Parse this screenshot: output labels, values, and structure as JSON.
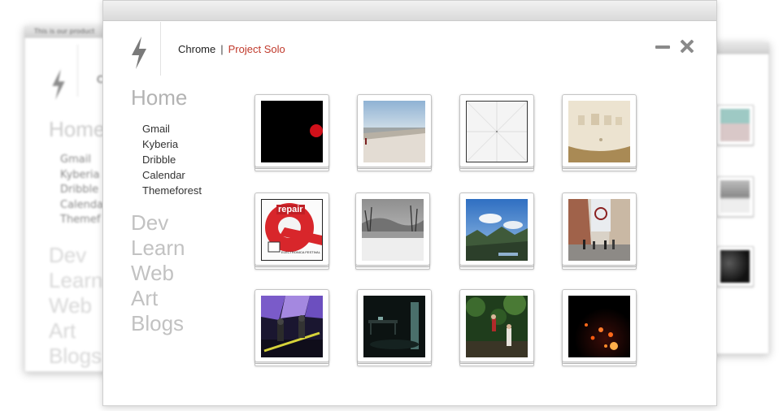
{
  "background_left_window": {
    "title": "This is our product",
    "brand_initial": "C",
    "home_label": "Home",
    "home_links": [
      "Gmail",
      "Kyberia",
      "Dribble",
      "Calenda",
      "Themef"
    ],
    "categories": [
      "Dev",
      "Learn",
      "Web",
      "Art",
      "Blogs"
    ]
  },
  "header": {
    "app_name": "Chrome",
    "separator": "|",
    "project": "Project Solo"
  },
  "sidebar": {
    "home_label": "Home",
    "home_links": [
      "Gmail",
      "Kyberia",
      "Dribble",
      "Calendar",
      "Themeforest"
    ],
    "categories": [
      "Dev",
      "Learn",
      "Web",
      "Art",
      "Blogs"
    ]
  },
  "thumbnails": [
    {
      "scene": "black-with-red-dot"
    },
    {
      "scene": "plaza-sky"
    },
    {
      "scene": "grid-placeholder"
    },
    {
      "scene": "sculpted-wall"
    },
    {
      "scene": "repair-poster",
      "text": "repair",
      "subtext": "ELECTRONICA FESTIVAL"
    },
    {
      "scene": "snowy-village"
    },
    {
      "scene": "mountain-valley"
    },
    {
      "scene": "city-street"
    },
    {
      "scene": "concert-lights"
    },
    {
      "scene": "dark-gallery"
    },
    {
      "scene": "forest-people"
    },
    {
      "scene": "night-lanterns"
    }
  ],
  "colors": {
    "accent": "#c0392b",
    "sidebar_heading": "#b3b3b3",
    "link": "#333333",
    "icon": "#8a8a8a"
  }
}
